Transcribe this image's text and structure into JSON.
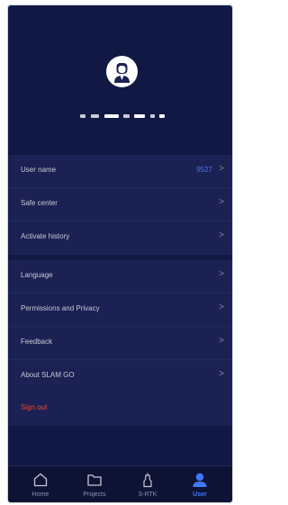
{
  "colors": {
    "background": "#111844",
    "row_background": "#1b2153",
    "accent": "#3e79ff",
    "danger": "#e64a3f",
    "tabbar_background": "#0e1335"
  },
  "profile": {
    "avatar_icon": "person-avatar-icon"
  },
  "account_section": {
    "items": [
      {
        "label": "User name",
        "value": "9527"
      },
      {
        "label": "Safe center"
      },
      {
        "label": "Activate history"
      }
    ]
  },
  "settings_section": {
    "items": [
      {
        "label": "Language"
      },
      {
        "label": "Permissions and Privacy"
      },
      {
        "label": "Feedback"
      },
      {
        "label": "About SLAM GO"
      }
    ]
  },
  "signout": {
    "label": "Sign out"
  },
  "chevron": ">",
  "tabs": [
    {
      "label": "Home",
      "icon": "home-icon",
      "active": false
    },
    {
      "label": "Projects",
      "icon": "folder-icon",
      "active": false
    },
    {
      "label": "S-RTK",
      "icon": "rtk-device-icon",
      "active": false
    },
    {
      "label": "User",
      "icon": "user-icon",
      "active": true
    }
  ]
}
